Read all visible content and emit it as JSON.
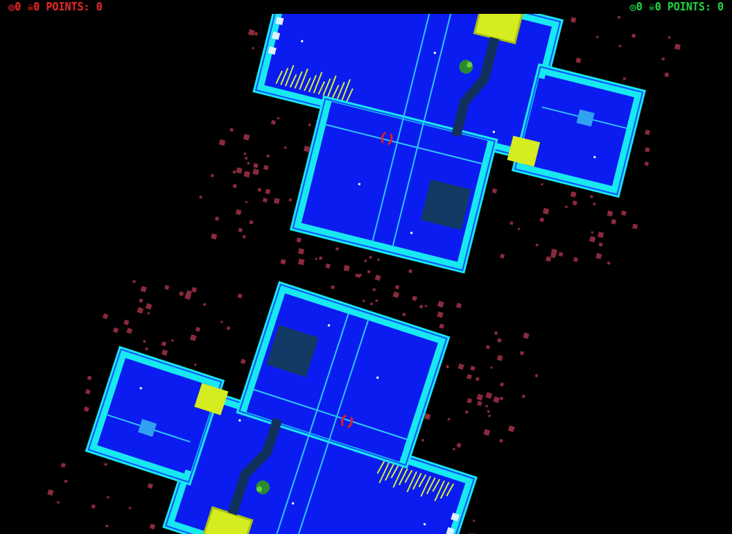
{
  "hud": [
    {
      "player": "1",
      "icon_a": "◎",
      "count_a": "0",
      "icon_b": "☠",
      "count_b": "0",
      "label": "POINTS:",
      "points": "0",
      "color": "#e02828"
    },
    {
      "player": "2",
      "icon_a": "◎",
      "count_a": "0",
      "icon_b": "☠",
      "count_b": "0",
      "label": "POINTS:",
      "points": "0",
      "color": "#20d040"
    }
  ]
}
